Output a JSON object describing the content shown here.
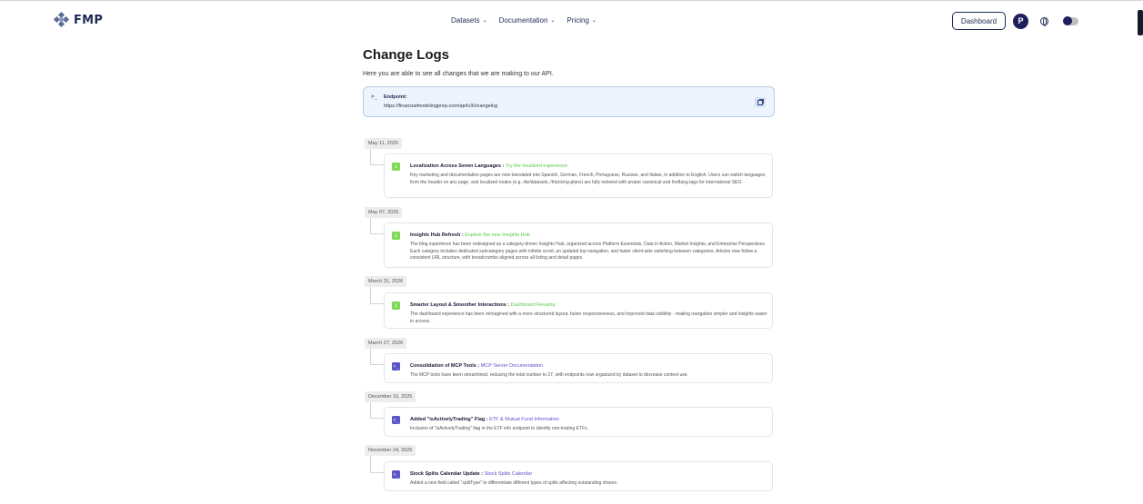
{
  "header": {
    "logo_text": "FMP",
    "nav": [
      {
        "label": "Datasets"
      },
      {
        "label": "Documentation"
      },
      {
        "label": "Pricing"
      }
    ],
    "dashboard_label": "Dashboard",
    "avatar_initial": "P"
  },
  "page": {
    "title": "Change Logs",
    "subtitle": "Here you are able to see all changes that we are making to our API."
  },
  "endpoint": {
    "prompt": ">_",
    "label": "Endpoint:",
    "url": "https://financialmodelingprep.com/api/v3/changelog"
  },
  "entries": [
    {
      "date": "May 11, 2026",
      "icon": "info-icon",
      "title": "Localization Across Seven Languages : ",
      "link": "Try the localized experience",
      "link_color": "green",
      "description": "Key marketing and documentation pages are now translated into Spanish, German, French, Portuguese, Russian, and Italian, in addition to English. Users can switch languages from the header on any page, and localized routes (e.g. /de/datasets, /fr/pricing-plans) are fully indexed with proper canonical and hreflang tags for international SEO."
    },
    {
      "date": "May 07, 2026",
      "icon": "info-icon",
      "title": "Insights Hub Refresh : ",
      "link": "Explore the new Insights Hub",
      "link_color": "green",
      "description": "The blog experience has been redesigned as a category-driven Insights Hub, organized across Platform Essentials, Data in Action, Market Insights, and Enterprise Perspectives. Each category includes dedicated subcategory pages with infinite scroll, an updated top navigation, and faster client-side switching between categories. Articles now follow a consistent URL structure, with breadcrumbs aligned across all listing and detail pages."
    },
    {
      "date": "March 31, 2026",
      "icon": "info-icon",
      "title": "Smarter Layout & Smoother Interactions : ",
      "link": "Dashboard Revamp",
      "link_color": "green",
      "description": "The dashboard experience has been reimagined with a more structured layout, faster responsiveness, and improved data visibility - making navigation simpler and insights easier to access."
    },
    {
      "date": "March 27, 2026",
      "icon": "terminal-icon",
      "title": "Consolidation of MCP Tools : ",
      "link": "MCP Server Documentation",
      "link_color": "blue",
      "description": "The MCP tools have been streamlined, reducing the total number to 27, with endpoints now organized by dataset to decrease context use."
    },
    {
      "date": "December 16, 2025",
      "icon": "terminal-icon",
      "title": "Added \"isActivelyTrading\" Flag : ",
      "link": "ETF & Mutual Fund Information",
      "link_color": "blue",
      "description": "Inclusion of \"isActivelyTrading\" flag in the ETF info endpoint to identify non-trading ETFs."
    },
    {
      "date": "November 24, 2025",
      "icon": "terminal-icon",
      "title": "Stock Splits Calendar Update : ",
      "link": "Stock Splits Calendar",
      "link_color": "blue",
      "description": "Added a new field called \"splitType\" to differentiate different types of splits affecting outstanding shares."
    }
  ]
}
